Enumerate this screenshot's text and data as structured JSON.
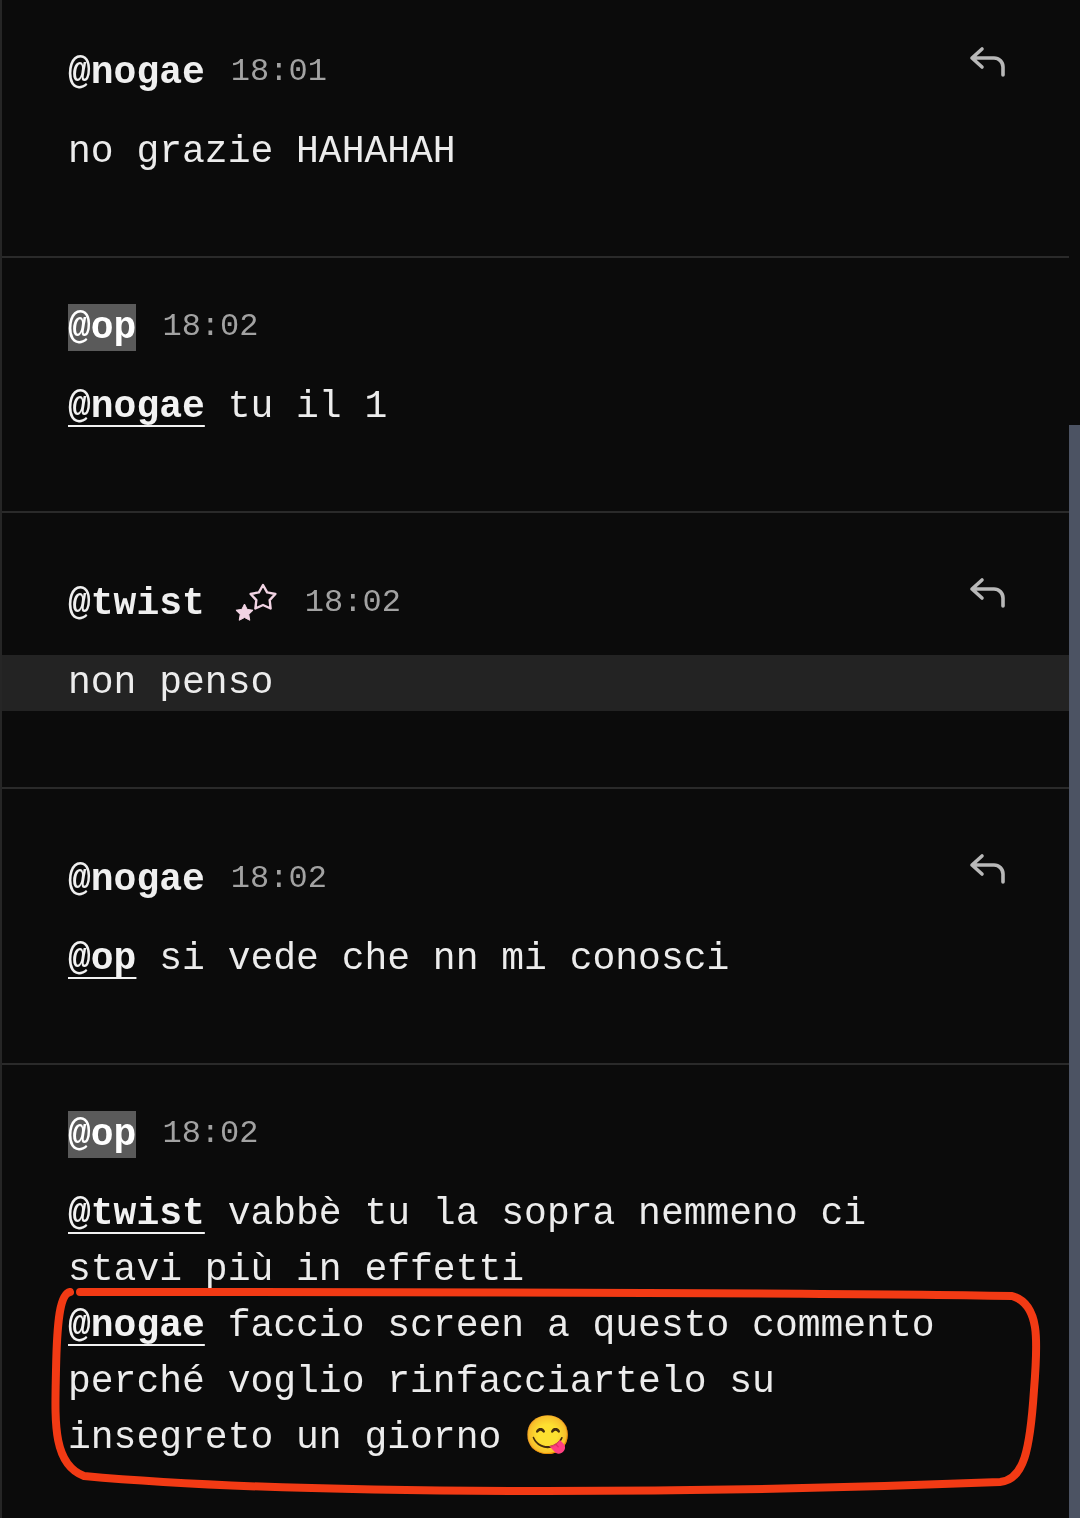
{
  "comments": [
    {
      "author": "@nogae",
      "author_highlighted": false,
      "badge": false,
      "time": "18:01",
      "reply_button": true,
      "paragraphs": [
        {
          "highlighted": false,
          "circled": false,
          "segments": [
            {
              "kind": "text",
              "text": "no grazie HAHAHAH"
            }
          ]
        }
      ]
    },
    {
      "author": "@op",
      "author_highlighted": true,
      "badge": false,
      "time": "18:02",
      "reply_button": false,
      "paragraphs": [
        {
          "highlighted": false,
          "circled": false,
          "segments": [
            {
              "kind": "mention",
              "text": "@nogae"
            },
            {
              "kind": "text",
              "text": " tu il 1"
            }
          ]
        }
      ]
    },
    {
      "author": "@twist",
      "author_highlighted": false,
      "badge": true,
      "time": "18:02",
      "reply_button": true,
      "paragraphs": [
        {
          "highlighted": true,
          "circled": false,
          "segments": [
            {
              "kind": "text",
              "text": "non penso"
            }
          ]
        }
      ]
    },
    {
      "author": "@nogae",
      "author_highlighted": false,
      "badge": false,
      "time": "18:02",
      "reply_button": true,
      "paragraphs": [
        {
          "highlighted": false,
          "circled": false,
          "segments": [
            {
              "kind": "mention",
              "text": "@op"
            },
            {
              "kind": "text",
              "text": " si vede che nn mi conosci"
            }
          ]
        }
      ]
    },
    {
      "author": "@op",
      "author_highlighted": true,
      "badge": false,
      "time": "18:02",
      "reply_button": false,
      "paragraphs": [
        {
          "highlighted": false,
          "circled": false,
          "segments": [
            {
              "kind": "mention",
              "text": "@twist"
            },
            {
              "kind": "text",
              "text": " vabbè tu la sopra nemmeno ci stavi più in effetti"
            }
          ]
        },
        {
          "highlighted": false,
          "circled": true,
          "segments": [
            {
              "kind": "mention",
              "text": "@nogae"
            },
            {
              "kind": "text",
              "text": " faccio screen a questo commento perché voglio rinfacciartelo su insegreto un giorno 😋"
            }
          ]
        }
      ]
    }
  ]
}
